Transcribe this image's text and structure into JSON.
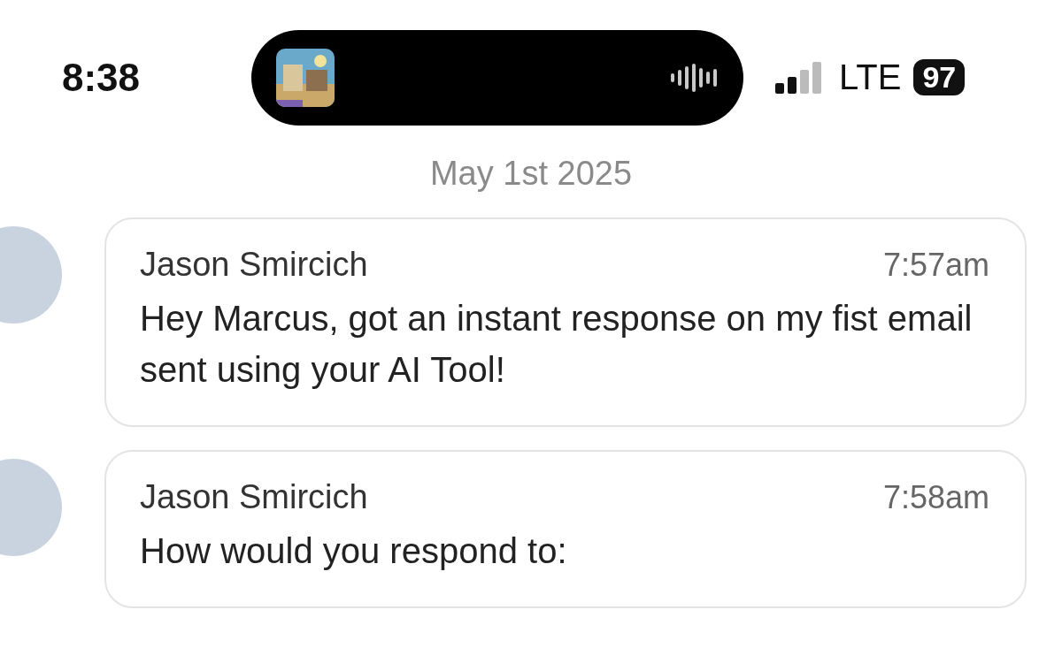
{
  "status_bar": {
    "time": "8:38",
    "network": "LTE",
    "battery": "97"
  },
  "date": "May 1st 2025",
  "messages": [
    {
      "sender": "Jason Smircich",
      "time": "7:57am",
      "text": "Hey Marcus, got an instant response on my fist email sent using your AI Tool!"
    },
    {
      "sender": "Jason Smircich",
      "time": "7:58am",
      "text": "How would you respond to:"
    }
  ]
}
